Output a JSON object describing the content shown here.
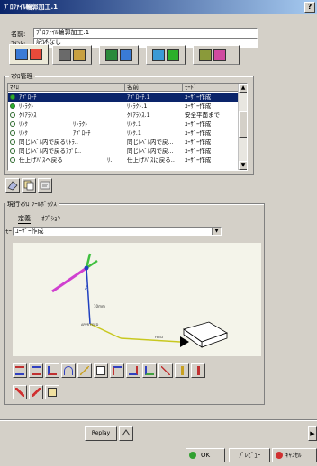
{
  "window": {
    "title": "ﾌﾟﾛﾌｧｲﾙ輪郭加工.1",
    "help_label": "?"
  },
  "fields": {
    "name_label": "名前:",
    "name_value": "ﾌﾟﾛﾌｧｲﾙ輪郭加工.1",
    "comment_label": "ｺﾒﾝﾄ:",
    "comment_value": "記述なし"
  },
  "tabs": [
    {
      "icon": "geometry-tab-icon"
    },
    {
      "icon": "tool-tab-icon"
    },
    {
      "icon": "feeds-speeds-tab-icon"
    },
    {
      "icon": "strategy-tab-icon"
    },
    {
      "icon": "macro-tab-icon"
    }
  ],
  "macro_group": {
    "title": "ﾏｸﾛ管理",
    "columns": [
      "ﾏｸﾛ",
      "名前",
      "ﾓｰﾄﾞ"
    ],
    "rows": [
      {
        "macro": "ｱﾌﾟﾛｰﾁ",
        "sub": "",
        "name": "ｱﾌﾟﾛｰﾁ.1",
        "mode": "ﾕｰｻﾞｰ作成",
        "state": "on",
        "selected": true
      },
      {
        "macro": "ﾘﾄﾗｸﾄ",
        "sub": "",
        "name": "ﾘﾄﾗｸﾄ.1",
        "mode": "ﾕｰｻﾞｰ作成",
        "state": "on",
        "selected": false
      },
      {
        "macro": "ｸﾘｱﾗﾝｽ",
        "sub": "",
        "name": "ｸﾘｱﾗﾝｽ.1",
        "mode": "安全平面まで",
        "state": "off",
        "selected": false
      },
      {
        "macro": "ﾘﾝｸ",
        "sub": "ﾘﾄﾗｸﾄ",
        "name": "ﾘﾝｸ.1",
        "mode": "ﾕｰｻﾞｰ作成",
        "state": "off",
        "selected": false
      },
      {
        "macro": "ﾘﾝｸ",
        "sub": "ｱﾌﾟﾛｰﾁ",
        "name": "ﾘﾝｸ.1",
        "mode": "ﾕｰｻﾞｰ作成",
        "state": "off",
        "selected": false
      },
      {
        "macro": "同じﾚﾍﾞﾙ内で戻るﾘﾄﾗ..",
        "sub": "",
        "name": "同じﾚﾍﾞﾙ内で戻...",
        "mode": "ﾕｰｻﾞｰ作成",
        "state": "off",
        "selected": false
      },
      {
        "macro": "同じﾚﾍﾞﾙ内で戻るｱﾌﾟﾛ..",
        "sub": "",
        "name": "同じﾚﾍﾞﾙ内で戻...",
        "mode": "ﾕｰｻﾞｰ作成",
        "state": "off",
        "selected": false
      },
      {
        "macro": "仕上げﾊﾟｽへ戻る",
        "sub": "ﾘ..",
        "name": "仕上げﾊﾟｽに戻る..",
        "mode": "ﾕｰｻﾞｰ作成",
        "state": "off",
        "selected": false
      }
    ],
    "scroll_up": "▲",
    "scroll_down": "▼"
  },
  "toolbox": {
    "title": "現行ﾏｸﾛ ﾂｰﾙﾎﾞｯｸｽ",
    "subtabs": [
      "定義",
      "ｵﾌﾟｼｮﾝ"
    ],
    "mode_label": "ﾓｰﾄﾞ:",
    "mode_value": "ﾕｰｻﾞｰ作成",
    "dropdown_arrow": "▼",
    "diagram_labels": {
      "a": "A",
      "dim": "10mm",
      "feed1": "APPR FEED",
      "feed2": "FEED"
    }
  },
  "bottom": {
    "ok_label": "OK",
    "preview_label": "ﾌﾟﾚﾋﾞｭｰ",
    "cancel_label": "ｷｬﾝｾﾙ",
    "play_label": "▶",
    "small_btn": "Replay"
  }
}
